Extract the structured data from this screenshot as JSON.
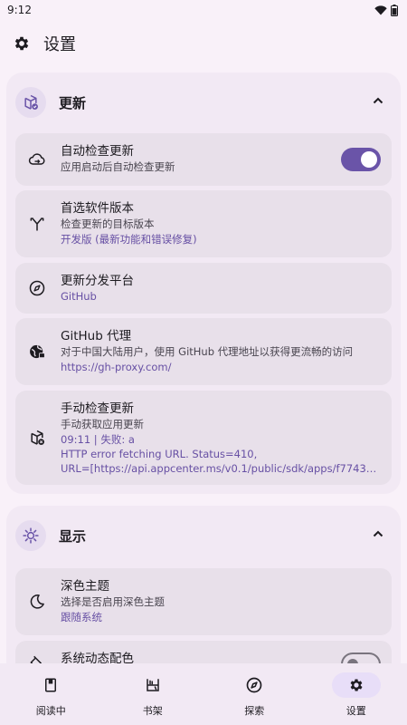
{
  "status_bar": {
    "time": "9:12"
  },
  "app_bar": {
    "title": "设置"
  },
  "sections": {
    "update": {
      "title": "更新",
      "items": {
        "auto_check": {
          "title": "自动检查更新",
          "subtitle": "应用启动后自动检查更新",
          "enabled": true
        },
        "preferred_version": {
          "title": "首选软件版本",
          "subtitle": "检查更新的目标版本",
          "value": "开发版 (最新功能和错误修复)"
        },
        "platform": {
          "title": "更新分发平台",
          "value": "GitHub"
        },
        "proxy": {
          "title": "GitHub 代理",
          "subtitle": "对于中国大陆用户，使用 GitHub 代理地址以获得更流畅的访问",
          "value": "https://gh-proxy.com/"
        },
        "manual_check": {
          "title": "手动检查更新",
          "subtitle": "手动获取应用更新",
          "status_line1": "09:11 | 失败: a",
          "status_line2": "HTTP error fetching URL. Status=410,",
          "status_line3": "URL=[https://api.appcenter.ms/v0.1/public/sdk/apps/f77438..."
        }
      }
    },
    "display": {
      "title": "显示",
      "items": {
        "dark_theme": {
          "title": "深色主题",
          "subtitle": "选择是否启用深色主题",
          "value": "跟随系统"
        },
        "dynamic_color": {
          "title": "系统动态配色",
          "enabled": false
        }
      }
    }
  },
  "bottom_nav": {
    "items": [
      {
        "label": "阅读中",
        "icon": "book-icon",
        "active": false
      },
      {
        "label": "书架",
        "icon": "bookshelf-icon",
        "active": false
      },
      {
        "label": "探索",
        "icon": "compass-icon",
        "active": false
      },
      {
        "label": "设置",
        "icon": "gear-icon",
        "active": true
      }
    ]
  },
  "colors": {
    "accent": "#6a54a8",
    "background": "#f9f1f9",
    "card": "#e8e0ea",
    "section": "#f2e9f4"
  }
}
